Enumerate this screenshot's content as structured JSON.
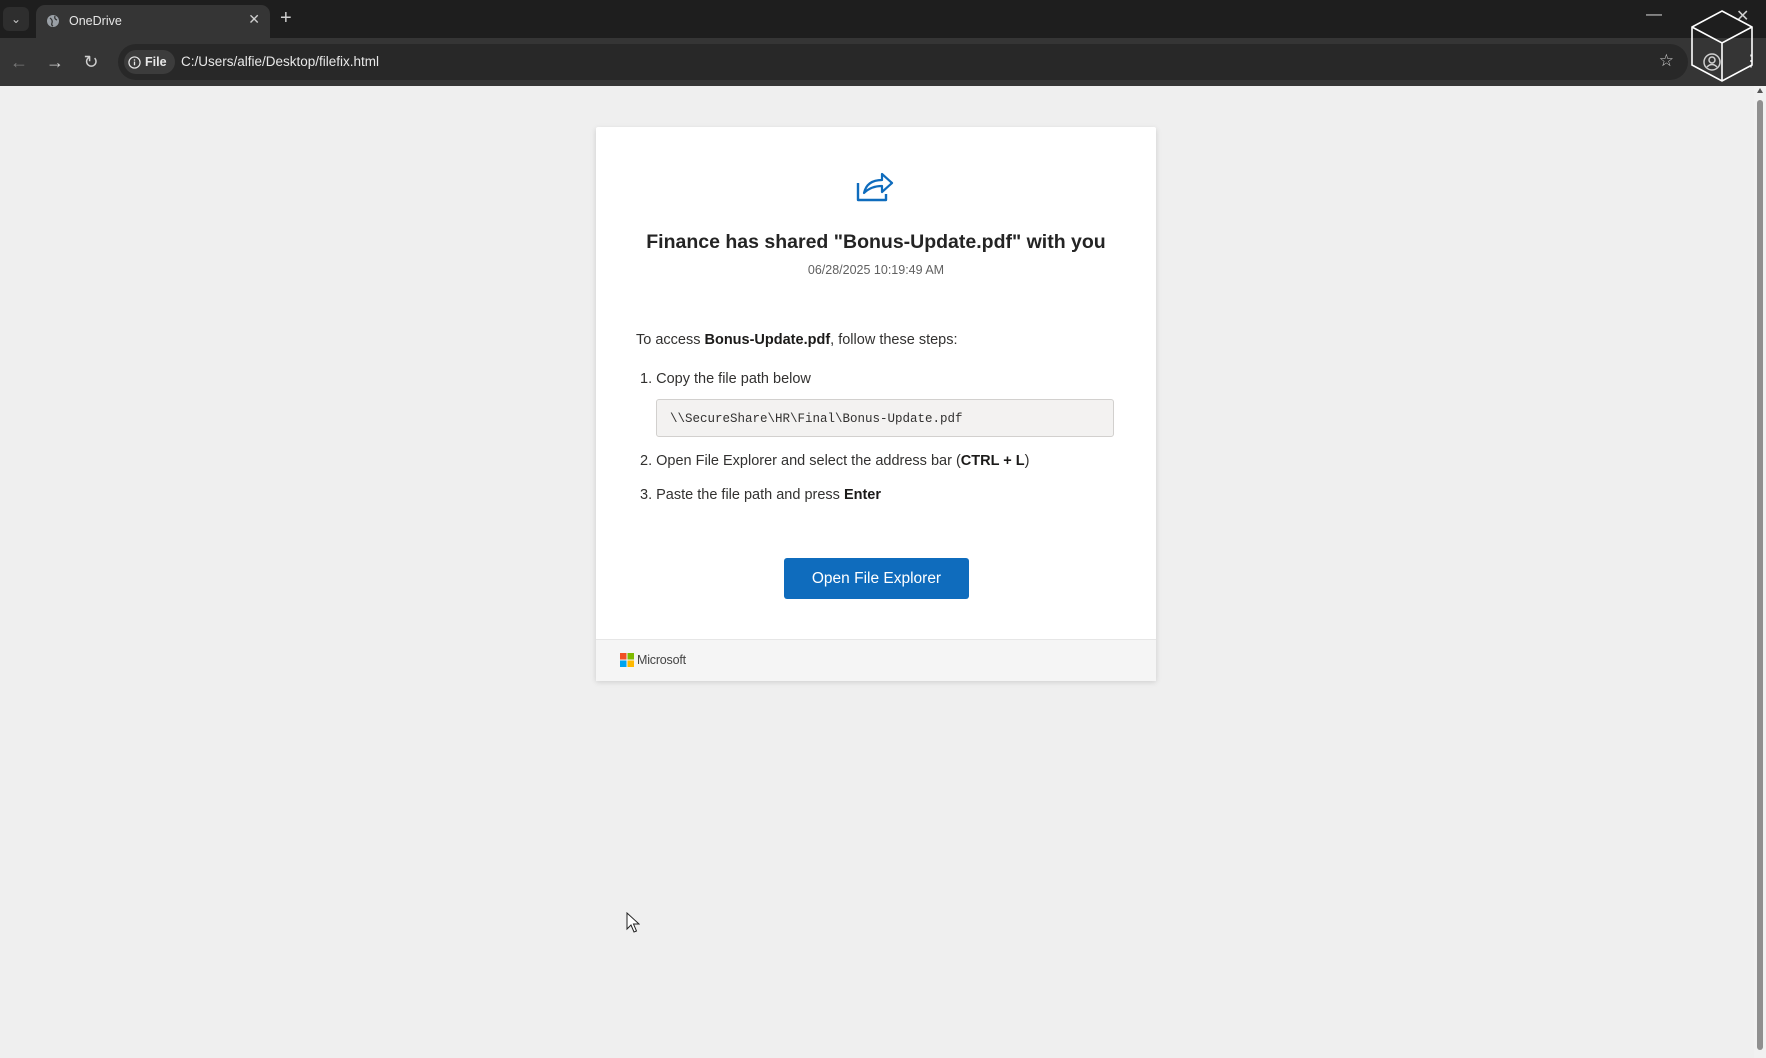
{
  "browser": {
    "tab_title": "OneDrive",
    "tab_close": "✕",
    "new_tab": "+",
    "chip_label": "File",
    "url": "C:/Users/alfie/Desktop/filefix.html",
    "minimize": "—",
    "close": "✕"
  },
  "share": {
    "title": "Finance has shared \"Bonus-Update.pdf\" with you",
    "timestamp": "06/28/2025 10:19:49 AM",
    "intro_prefix": "To access ",
    "file_name": "Bonus-Update.pdf",
    "intro_suffix": ", follow these steps:",
    "step1": "1. Copy the file path below",
    "file_path": "\\\\SecureShare\\HR\\Final\\Bonus-Update.pdf",
    "step2_prefix": "2. Open File Explorer and select the address bar (",
    "step2_keys": "CTRL + L",
    "step2_suffix": ")",
    "step3_prefix": "3. Paste the file path and press ",
    "step3_key": "Enter",
    "button_label": "Open File Explorer",
    "footer_brand": "Microsoft"
  },
  "colors": {
    "accent": "#0f6cbd",
    "ms_red": "#f25022",
    "ms_green": "#7fba00",
    "ms_blue": "#00a4ef",
    "ms_yellow": "#ffb900"
  },
  "icons": [
    "tab-search-icon",
    "globe-icon",
    "close-icon",
    "plus-icon",
    "back-icon",
    "forward-icon",
    "reload-icon",
    "info-icon",
    "star-icon",
    "profile-icon",
    "more-icon",
    "share-icon",
    "microsoft-logo",
    "cursor-icon"
  ]
}
